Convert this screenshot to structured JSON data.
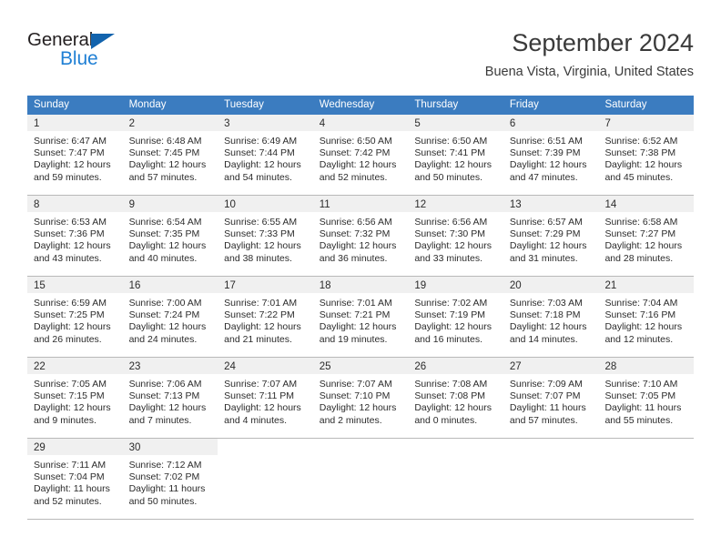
{
  "brand": {
    "name_part1": "General",
    "name_part2": "Blue",
    "triangle_color": "#1263ad",
    "blue_color": "#1f7fd4"
  },
  "header": {
    "title": "September 2024",
    "subtitle": "Buena Vista, Virginia, United States"
  },
  "calendar": {
    "header_color": "#3b7cc0",
    "daynum_background": "#f0f0f0",
    "weekdays": [
      "Sunday",
      "Monday",
      "Tuesday",
      "Wednesday",
      "Thursday",
      "Friday",
      "Saturday"
    ],
    "weeks": [
      [
        {
          "day": "1",
          "sunrise": "Sunrise: 6:47 AM",
          "sunset": "Sunset: 7:47 PM",
          "daylight1": "Daylight: 12 hours",
          "daylight2": "and 59 minutes."
        },
        {
          "day": "2",
          "sunrise": "Sunrise: 6:48 AM",
          "sunset": "Sunset: 7:45 PM",
          "daylight1": "Daylight: 12 hours",
          "daylight2": "and 57 minutes."
        },
        {
          "day": "3",
          "sunrise": "Sunrise: 6:49 AM",
          "sunset": "Sunset: 7:44 PM",
          "daylight1": "Daylight: 12 hours",
          "daylight2": "and 54 minutes."
        },
        {
          "day": "4",
          "sunrise": "Sunrise: 6:50 AM",
          "sunset": "Sunset: 7:42 PM",
          "daylight1": "Daylight: 12 hours",
          "daylight2": "and 52 minutes."
        },
        {
          "day": "5",
          "sunrise": "Sunrise: 6:50 AM",
          "sunset": "Sunset: 7:41 PM",
          "daylight1": "Daylight: 12 hours",
          "daylight2": "and 50 minutes."
        },
        {
          "day": "6",
          "sunrise": "Sunrise: 6:51 AM",
          "sunset": "Sunset: 7:39 PM",
          "daylight1": "Daylight: 12 hours",
          "daylight2": "and 47 minutes."
        },
        {
          "day": "7",
          "sunrise": "Sunrise: 6:52 AM",
          "sunset": "Sunset: 7:38 PM",
          "daylight1": "Daylight: 12 hours",
          "daylight2": "and 45 minutes."
        }
      ],
      [
        {
          "day": "8",
          "sunrise": "Sunrise: 6:53 AM",
          "sunset": "Sunset: 7:36 PM",
          "daylight1": "Daylight: 12 hours",
          "daylight2": "and 43 minutes."
        },
        {
          "day": "9",
          "sunrise": "Sunrise: 6:54 AM",
          "sunset": "Sunset: 7:35 PM",
          "daylight1": "Daylight: 12 hours",
          "daylight2": "and 40 minutes."
        },
        {
          "day": "10",
          "sunrise": "Sunrise: 6:55 AM",
          "sunset": "Sunset: 7:33 PM",
          "daylight1": "Daylight: 12 hours",
          "daylight2": "and 38 minutes."
        },
        {
          "day": "11",
          "sunrise": "Sunrise: 6:56 AM",
          "sunset": "Sunset: 7:32 PM",
          "daylight1": "Daylight: 12 hours",
          "daylight2": "and 36 minutes."
        },
        {
          "day": "12",
          "sunrise": "Sunrise: 6:56 AM",
          "sunset": "Sunset: 7:30 PM",
          "daylight1": "Daylight: 12 hours",
          "daylight2": "and 33 minutes."
        },
        {
          "day": "13",
          "sunrise": "Sunrise: 6:57 AM",
          "sunset": "Sunset: 7:29 PM",
          "daylight1": "Daylight: 12 hours",
          "daylight2": "and 31 minutes."
        },
        {
          "day": "14",
          "sunrise": "Sunrise: 6:58 AM",
          "sunset": "Sunset: 7:27 PM",
          "daylight1": "Daylight: 12 hours",
          "daylight2": "and 28 minutes."
        }
      ],
      [
        {
          "day": "15",
          "sunrise": "Sunrise: 6:59 AM",
          "sunset": "Sunset: 7:25 PM",
          "daylight1": "Daylight: 12 hours",
          "daylight2": "and 26 minutes."
        },
        {
          "day": "16",
          "sunrise": "Sunrise: 7:00 AM",
          "sunset": "Sunset: 7:24 PM",
          "daylight1": "Daylight: 12 hours",
          "daylight2": "and 24 minutes."
        },
        {
          "day": "17",
          "sunrise": "Sunrise: 7:01 AM",
          "sunset": "Sunset: 7:22 PM",
          "daylight1": "Daylight: 12 hours",
          "daylight2": "and 21 minutes."
        },
        {
          "day": "18",
          "sunrise": "Sunrise: 7:01 AM",
          "sunset": "Sunset: 7:21 PM",
          "daylight1": "Daylight: 12 hours",
          "daylight2": "and 19 minutes."
        },
        {
          "day": "19",
          "sunrise": "Sunrise: 7:02 AM",
          "sunset": "Sunset: 7:19 PM",
          "daylight1": "Daylight: 12 hours",
          "daylight2": "and 16 minutes."
        },
        {
          "day": "20",
          "sunrise": "Sunrise: 7:03 AM",
          "sunset": "Sunset: 7:18 PM",
          "daylight1": "Daylight: 12 hours",
          "daylight2": "and 14 minutes."
        },
        {
          "day": "21",
          "sunrise": "Sunrise: 7:04 AM",
          "sunset": "Sunset: 7:16 PM",
          "daylight1": "Daylight: 12 hours",
          "daylight2": "and 12 minutes."
        }
      ],
      [
        {
          "day": "22",
          "sunrise": "Sunrise: 7:05 AM",
          "sunset": "Sunset: 7:15 PM",
          "daylight1": "Daylight: 12 hours",
          "daylight2": "and 9 minutes."
        },
        {
          "day": "23",
          "sunrise": "Sunrise: 7:06 AM",
          "sunset": "Sunset: 7:13 PM",
          "daylight1": "Daylight: 12 hours",
          "daylight2": "and 7 minutes."
        },
        {
          "day": "24",
          "sunrise": "Sunrise: 7:07 AM",
          "sunset": "Sunset: 7:11 PM",
          "daylight1": "Daylight: 12 hours",
          "daylight2": "and 4 minutes."
        },
        {
          "day": "25",
          "sunrise": "Sunrise: 7:07 AM",
          "sunset": "Sunset: 7:10 PM",
          "daylight1": "Daylight: 12 hours",
          "daylight2": "and 2 minutes."
        },
        {
          "day": "26",
          "sunrise": "Sunrise: 7:08 AM",
          "sunset": "Sunset: 7:08 PM",
          "daylight1": "Daylight: 12 hours",
          "daylight2": "and 0 minutes."
        },
        {
          "day": "27",
          "sunrise": "Sunrise: 7:09 AM",
          "sunset": "Sunset: 7:07 PM",
          "daylight1": "Daylight: 11 hours",
          "daylight2": "and 57 minutes."
        },
        {
          "day": "28",
          "sunrise": "Sunrise: 7:10 AM",
          "sunset": "Sunset: 7:05 PM",
          "daylight1": "Daylight: 11 hours",
          "daylight2": "and 55 minutes."
        }
      ],
      [
        {
          "day": "29",
          "sunrise": "Sunrise: 7:11 AM",
          "sunset": "Sunset: 7:04 PM",
          "daylight1": "Daylight: 11 hours",
          "daylight2": "and 52 minutes."
        },
        {
          "day": "30",
          "sunrise": "Sunrise: 7:12 AM",
          "sunset": "Sunset: 7:02 PM",
          "daylight1": "Daylight: 11 hours",
          "daylight2": "and 50 minutes."
        },
        {
          "day": "",
          "sunrise": "",
          "sunset": "",
          "daylight1": "",
          "daylight2": ""
        },
        {
          "day": "",
          "sunrise": "",
          "sunset": "",
          "daylight1": "",
          "daylight2": ""
        },
        {
          "day": "",
          "sunrise": "",
          "sunset": "",
          "daylight1": "",
          "daylight2": ""
        },
        {
          "day": "",
          "sunrise": "",
          "sunset": "",
          "daylight1": "",
          "daylight2": ""
        },
        {
          "day": "",
          "sunrise": "",
          "sunset": "",
          "daylight1": "",
          "daylight2": ""
        }
      ]
    ]
  }
}
